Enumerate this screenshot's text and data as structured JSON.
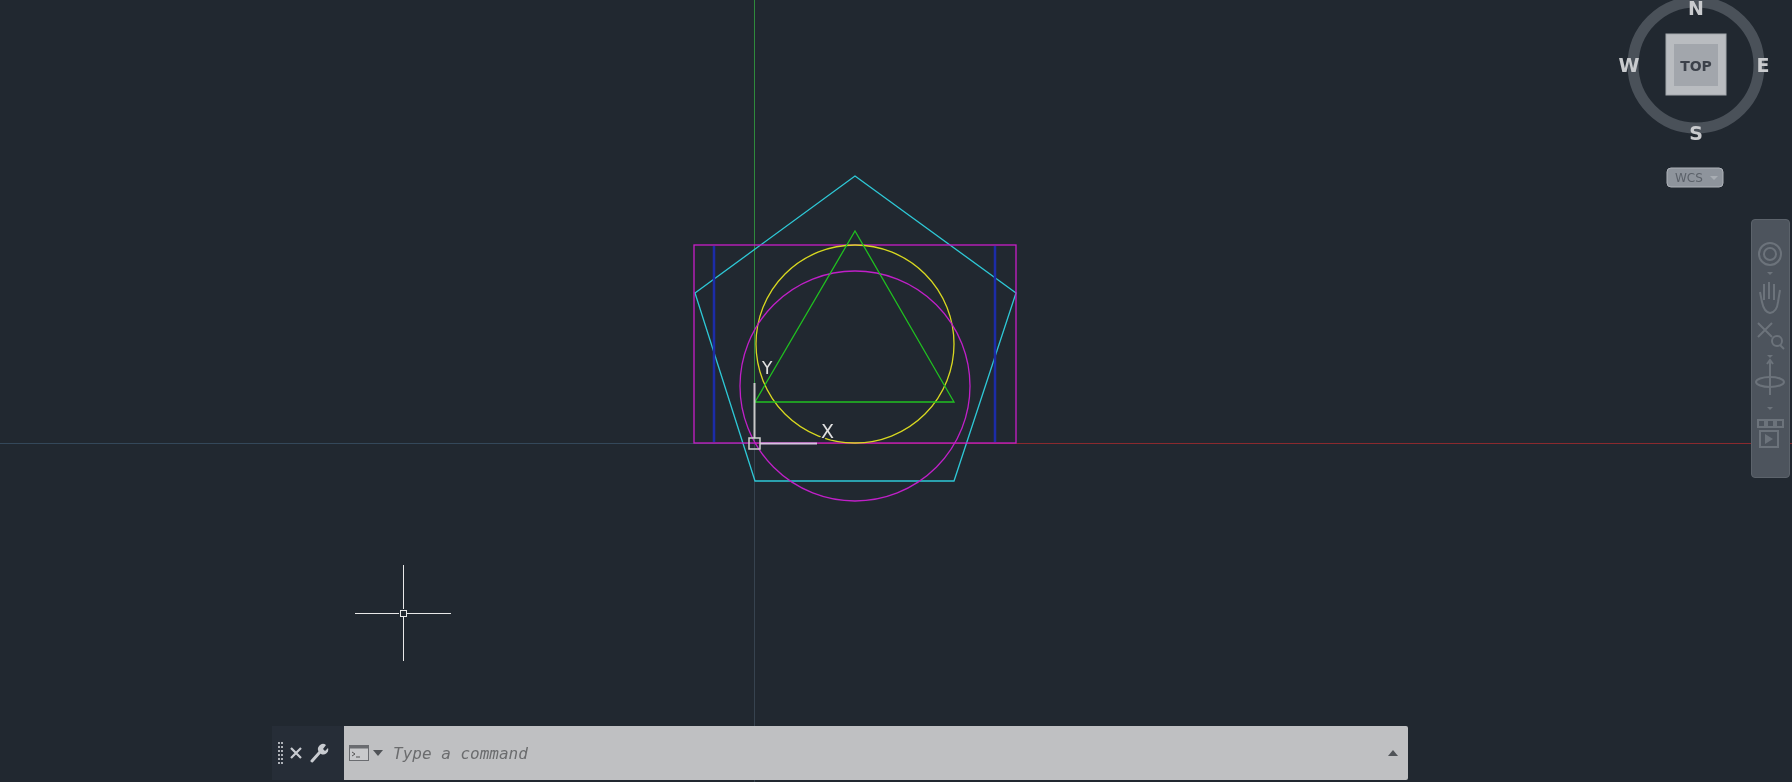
{
  "viewcube": {
    "north": "N",
    "west": "W",
    "east": "E",
    "south": "S",
    "face": "TOP",
    "coordinate_system": "WCS"
  },
  "ucs_icon": {
    "x_label": "X",
    "y_label": "Y"
  },
  "drawing": {
    "shapes": [
      {
        "kind": "pentagon",
        "color": "#2ec8d6"
      },
      {
        "kind": "rectangle",
        "color": "#c81ec8"
      },
      {
        "kind": "vertical-lines",
        "color": "#1c2ca8"
      },
      {
        "kind": "circle-upper",
        "color": "#d8d820"
      },
      {
        "kind": "circle-lower",
        "color": "#c020c8"
      },
      {
        "kind": "triangle",
        "color": "#20c020"
      }
    ]
  },
  "command_line": {
    "placeholder": "Type a command"
  }
}
